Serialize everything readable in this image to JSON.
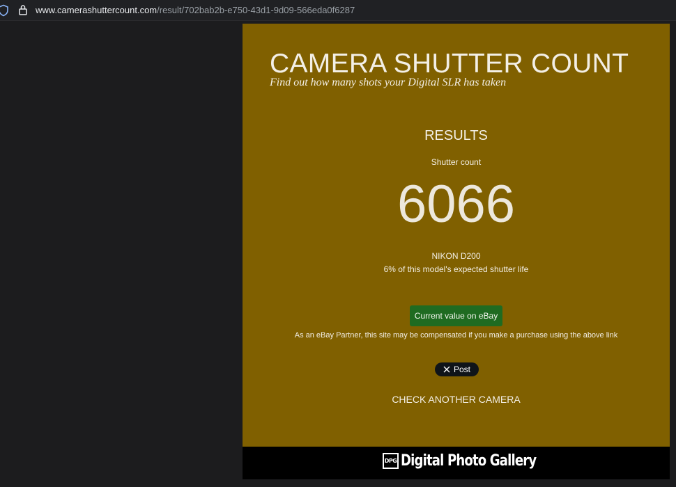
{
  "browser": {
    "url_domain": "www.camerashuttercount.com",
    "url_path": "/result/702bab2b-e750-43d1-9d09-566eda0f6287"
  },
  "site": {
    "title": "CAMERA SHUTTER COUNT",
    "tagline": "Find out how many shots your Digital SLR has taken"
  },
  "results": {
    "heading": "RESULTS",
    "count_label": "Shutter count",
    "count_value": "6066",
    "model": "NIKON D200",
    "life_text": "6% of this model's expected shutter life"
  },
  "actions": {
    "ebay_button": "Current value on eBay",
    "disclaimer": "As an eBay Partner, this site may be compensated if you make a purchase using the above link",
    "x_post": "Post",
    "check_another": "CHECK ANOTHER CAMERA"
  },
  "footer": {
    "brand_badge": "DPG",
    "brand_name": "Digital Photo Gallery"
  },
  "colors": {
    "panel_bg": "#806000",
    "ebay_button_bg": "#1f6b21",
    "page_bg": "#1c1c1e",
    "footer_bg": "#000000"
  }
}
